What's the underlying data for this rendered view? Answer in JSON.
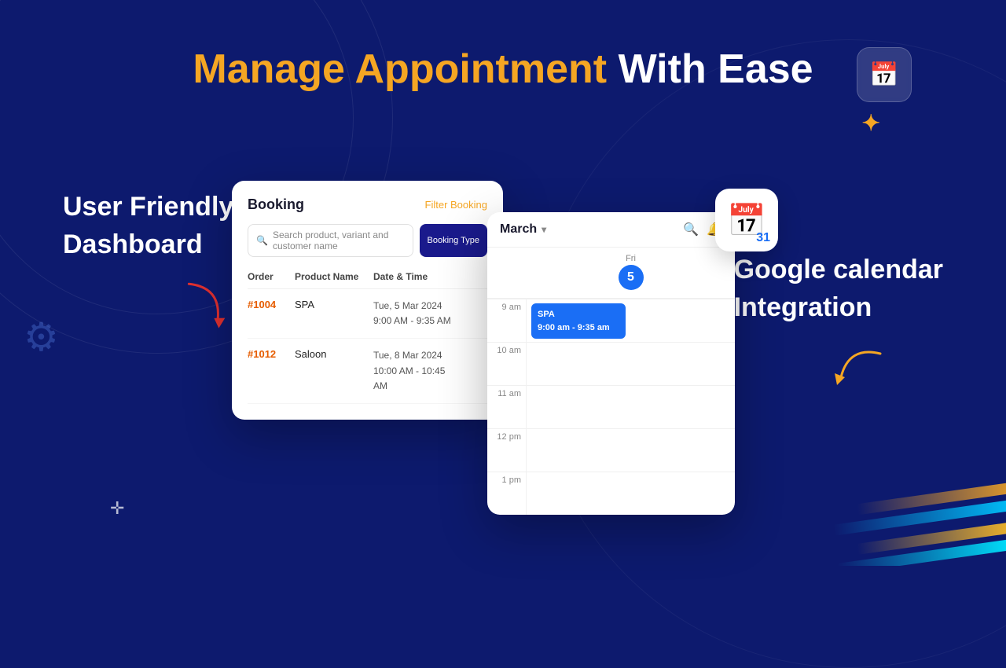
{
  "page": {
    "background_color": "#0d1a6e"
  },
  "header": {
    "title_orange": "Manage Appointment",
    "title_white": " With Ease"
  },
  "left_section": {
    "line1": "User Friendly",
    "line2": "Dashboard"
  },
  "right_section": {
    "line1": "Google calendar",
    "line2": "Integration"
  },
  "booking_panel": {
    "title": "Booking",
    "filter_link": "Filter Booking",
    "search_placeholder": "Search product, variant and customer name",
    "booking_type_btn": "Booking Type",
    "columns": [
      "Order",
      "Product Name",
      "Date & Time",
      ""
    ],
    "rows": [
      {
        "order": "#1004",
        "product": "SPA",
        "date": "Tue, 5 Mar 2024",
        "time": "9:00 AM - 9:35 AM"
      },
      {
        "order": "#1012",
        "product": "Saloon",
        "date": "Tue, 8 Mar 2024",
        "time": "10:00 AM - 10:45 AM"
      }
    ]
  },
  "calendar_panel": {
    "month": "March",
    "day_name": "Fri",
    "day_number": "5",
    "time_slots": [
      "9 am",
      "10 am",
      "11 am",
      "12 pm",
      "1 pm"
    ],
    "event": {
      "title": "SPA",
      "time": "9:00 am - 9:35 am"
    }
  }
}
